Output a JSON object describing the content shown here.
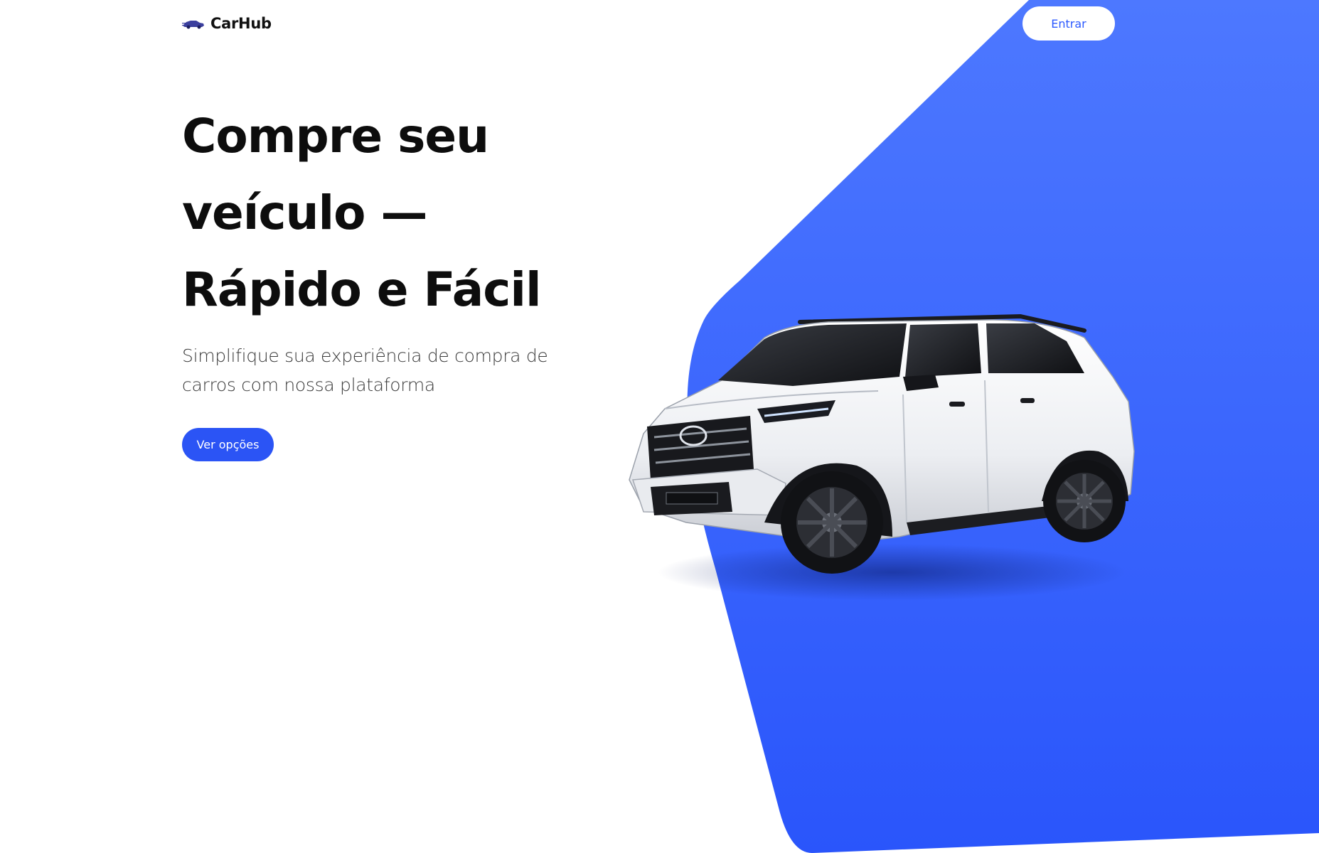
{
  "header": {
    "logo_text": "CarHub",
    "logo_icon": "car-icon",
    "login_label": "Entrar"
  },
  "hero": {
    "title_lines": [
      "Compre seu",
      "veículo —",
      "Rápido e Fácil"
    ],
    "subtitle": "Simplifique sua experiência de compra de carros com nossa plataforma",
    "cta_label": "Ver opções",
    "image": "white-suv-car"
  },
  "colors": {
    "accent": "#2b54f5",
    "accent_light": "#4a74ff",
    "text_dark": "#0d0d0d",
    "text_muted": "#3a3a3a",
    "background": "#ffffff"
  }
}
